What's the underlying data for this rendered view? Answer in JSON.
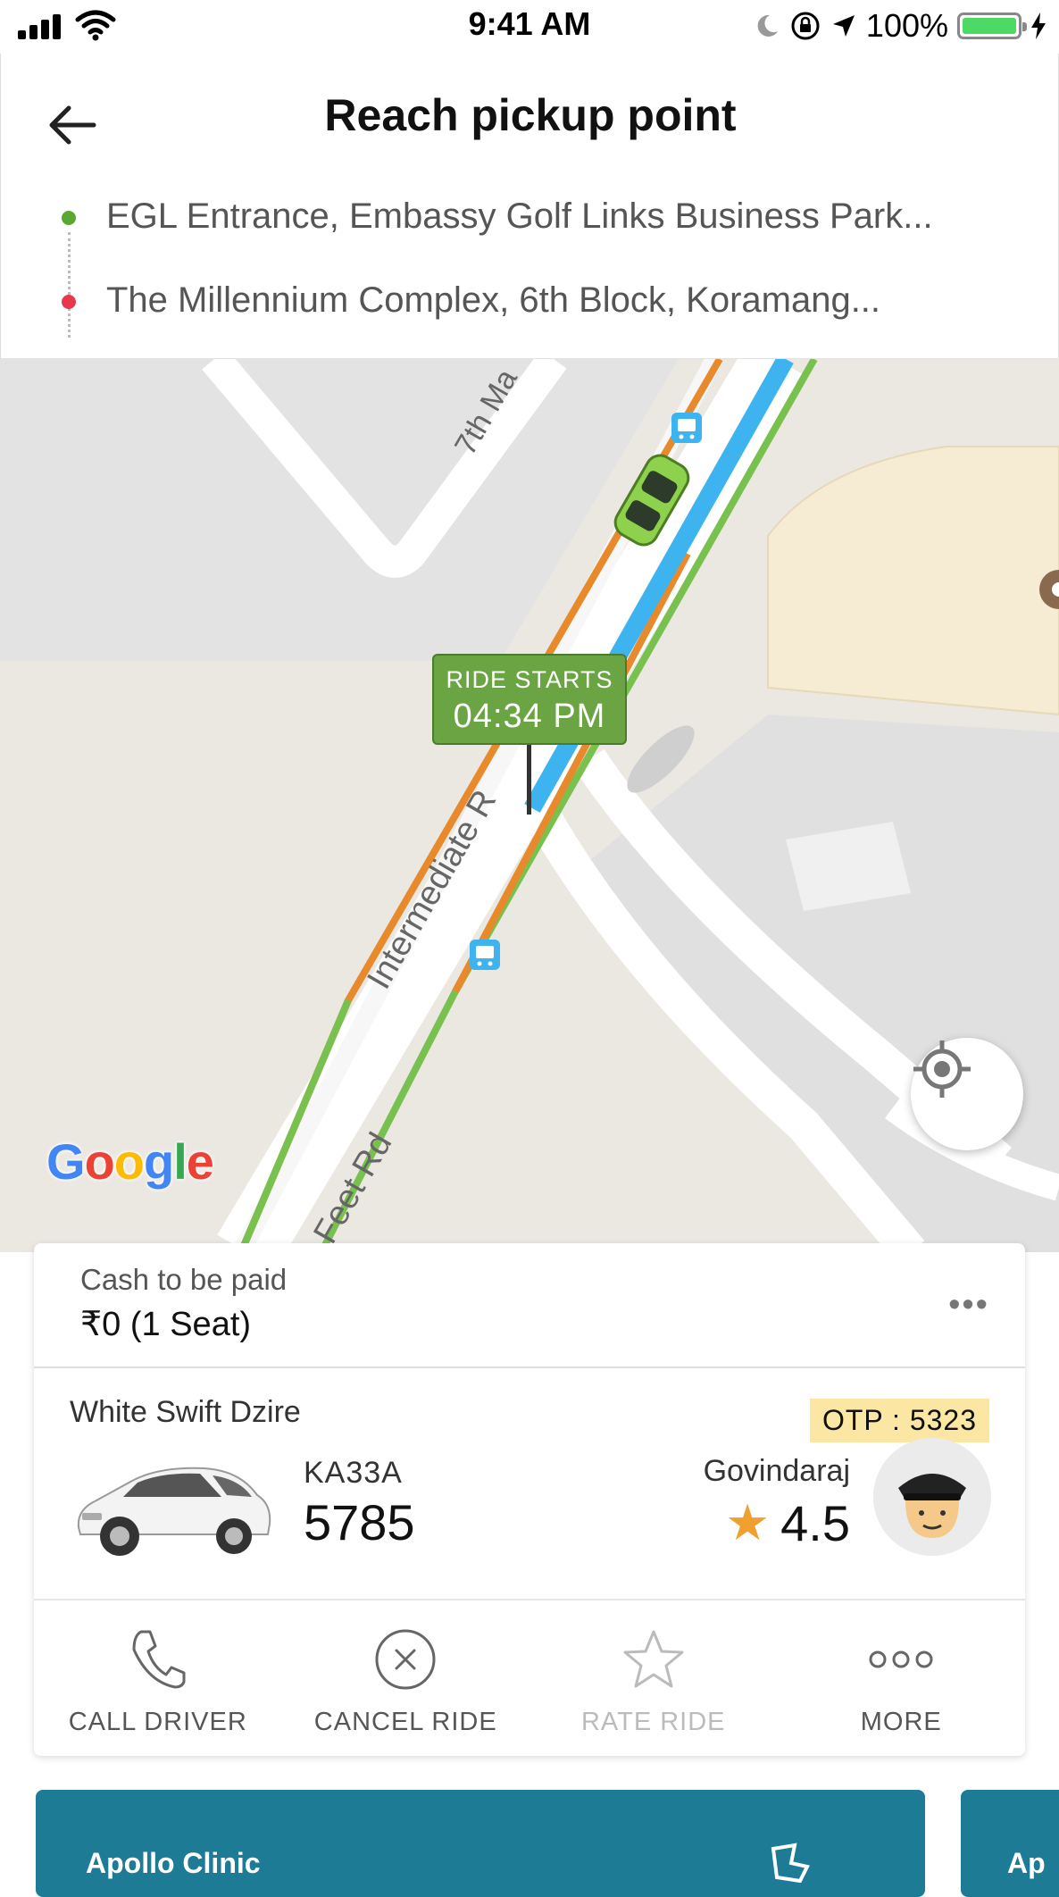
{
  "status_bar": {
    "time": "9:41 AM",
    "battery": "100%",
    "battery_level": 1.0
  },
  "header": {
    "title": "Reach pickup point",
    "pickup": "EGL Entrance, Embassy Golf Links Business Park...",
    "drop": "The Millennium Complex, 6th Block, Koramang..."
  },
  "map": {
    "ride_starts_label": "RIDE STARTS",
    "ride_starts_time": "04:34 PM",
    "roads": [
      "7th Ma",
      "Intermediate R",
      "Feet Rd"
    ],
    "provider": "Google"
  },
  "payment": {
    "label": "Cash to be paid",
    "value": "₹0 (1 Seat)",
    "more": "•••"
  },
  "driver": {
    "car_model": "White Swift Dzire",
    "otp": "OTP : 5323",
    "plate_prefix": "KA33A",
    "plate_number": "5785",
    "name": "Govindaraj",
    "rating": "4.5"
  },
  "actions": [
    {
      "label": "CALL DRIVER",
      "icon": "phone-icon",
      "enabled": true
    },
    {
      "label": "CANCEL RIDE",
      "icon": "cancel-circle-icon",
      "enabled": true
    },
    {
      "label": "RATE RIDE",
      "icon": "star-outline-icon",
      "enabled": false
    },
    {
      "label": "MORE",
      "icon": "more-dots-icon",
      "enabled": true
    }
  ],
  "banner": {
    "brand": "Apollo Clinic",
    "brand_partial": "Ap"
  },
  "colors": {
    "route_blue": "#3db3f0",
    "traffic_orange": "#e8892b",
    "traffic_green": "#79c14f",
    "marker_green": "#6aa443",
    "otp_bg": "#fbe6a3",
    "banner": "#1e7b95"
  }
}
